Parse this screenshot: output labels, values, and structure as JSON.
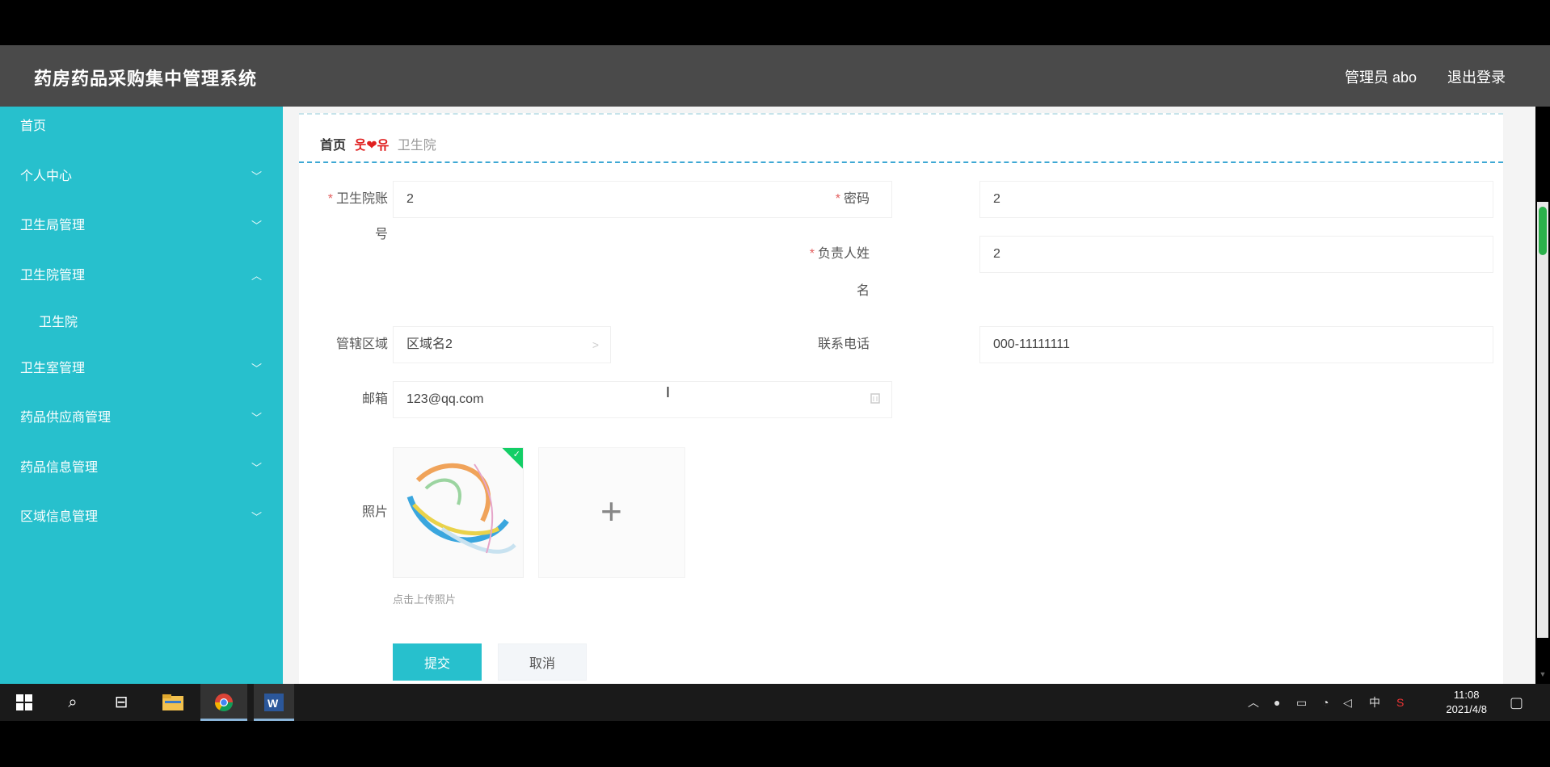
{
  "header": {
    "title": "药房药品采购集中管理系统",
    "admin": "管理员 abo",
    "logout": "退出登录"
  },
  "sidebar": {
    "items": [
      {
        "label": "首页",
        "chevron": ""
      },
      {
        "label": "个人中心",
        "chevron": "﹀"
      },
      {
        "label": "卫生局管理",
        "chevron": "﹀"
      },
      {
        "label": "卫生院管理",
        "chevron": "︿"
      },
      {
        "label": "卫生院",
        "chevron": ""
      },
      {
        "label": "卫生室管理",
        "chevron": "﹀"
      },
      {
        "label": "药品供应商管理",
        "chevron": "﹀"
      },
      {
        "label": "药品信息管理",
        "chevron": "﹀"
      },
      {
        "label": "区域信息管理",
        "chevron": "﹀"
      }
    ]
  },
  "breadcrumb": {
    "home": "首页",
    "separator": "웃❤유",
    "current": "卫生院"
  },
  "form": {
    "account_label_1": "卫生院账",
    "account_label_2": "号",
    "account_value": "2",
    "password_label": "密码",
    "password_value": "2",
    "manager_label_1": "负责人姓",
    "manager_label_2": "名",
    "manager_value": "2",
    "region_label": "管辖区域",
    "region_value": "区域名2",
    "region_suffix": ">",
    "phone_label": "联系电话",
    "phone_value": "000-11111111",
    "email_label": "邮箱",
    "email_value": "123@qq.com",
    "photo_label": "照片",
    "upload_hint": "点击上传照片",
    "submit": "提交",
    "cancel": "取消",
    "required_mark": "*"
  },
  "taskbar": {
    "time": "11:08",
    "date": "2021/4/8",
    "ime": "中"
  },
  "colors": {
    "sidebar": "#27c0cd",
    "header": "#4a4a4a",
    "accent": "#27c0cd"
  }
}
